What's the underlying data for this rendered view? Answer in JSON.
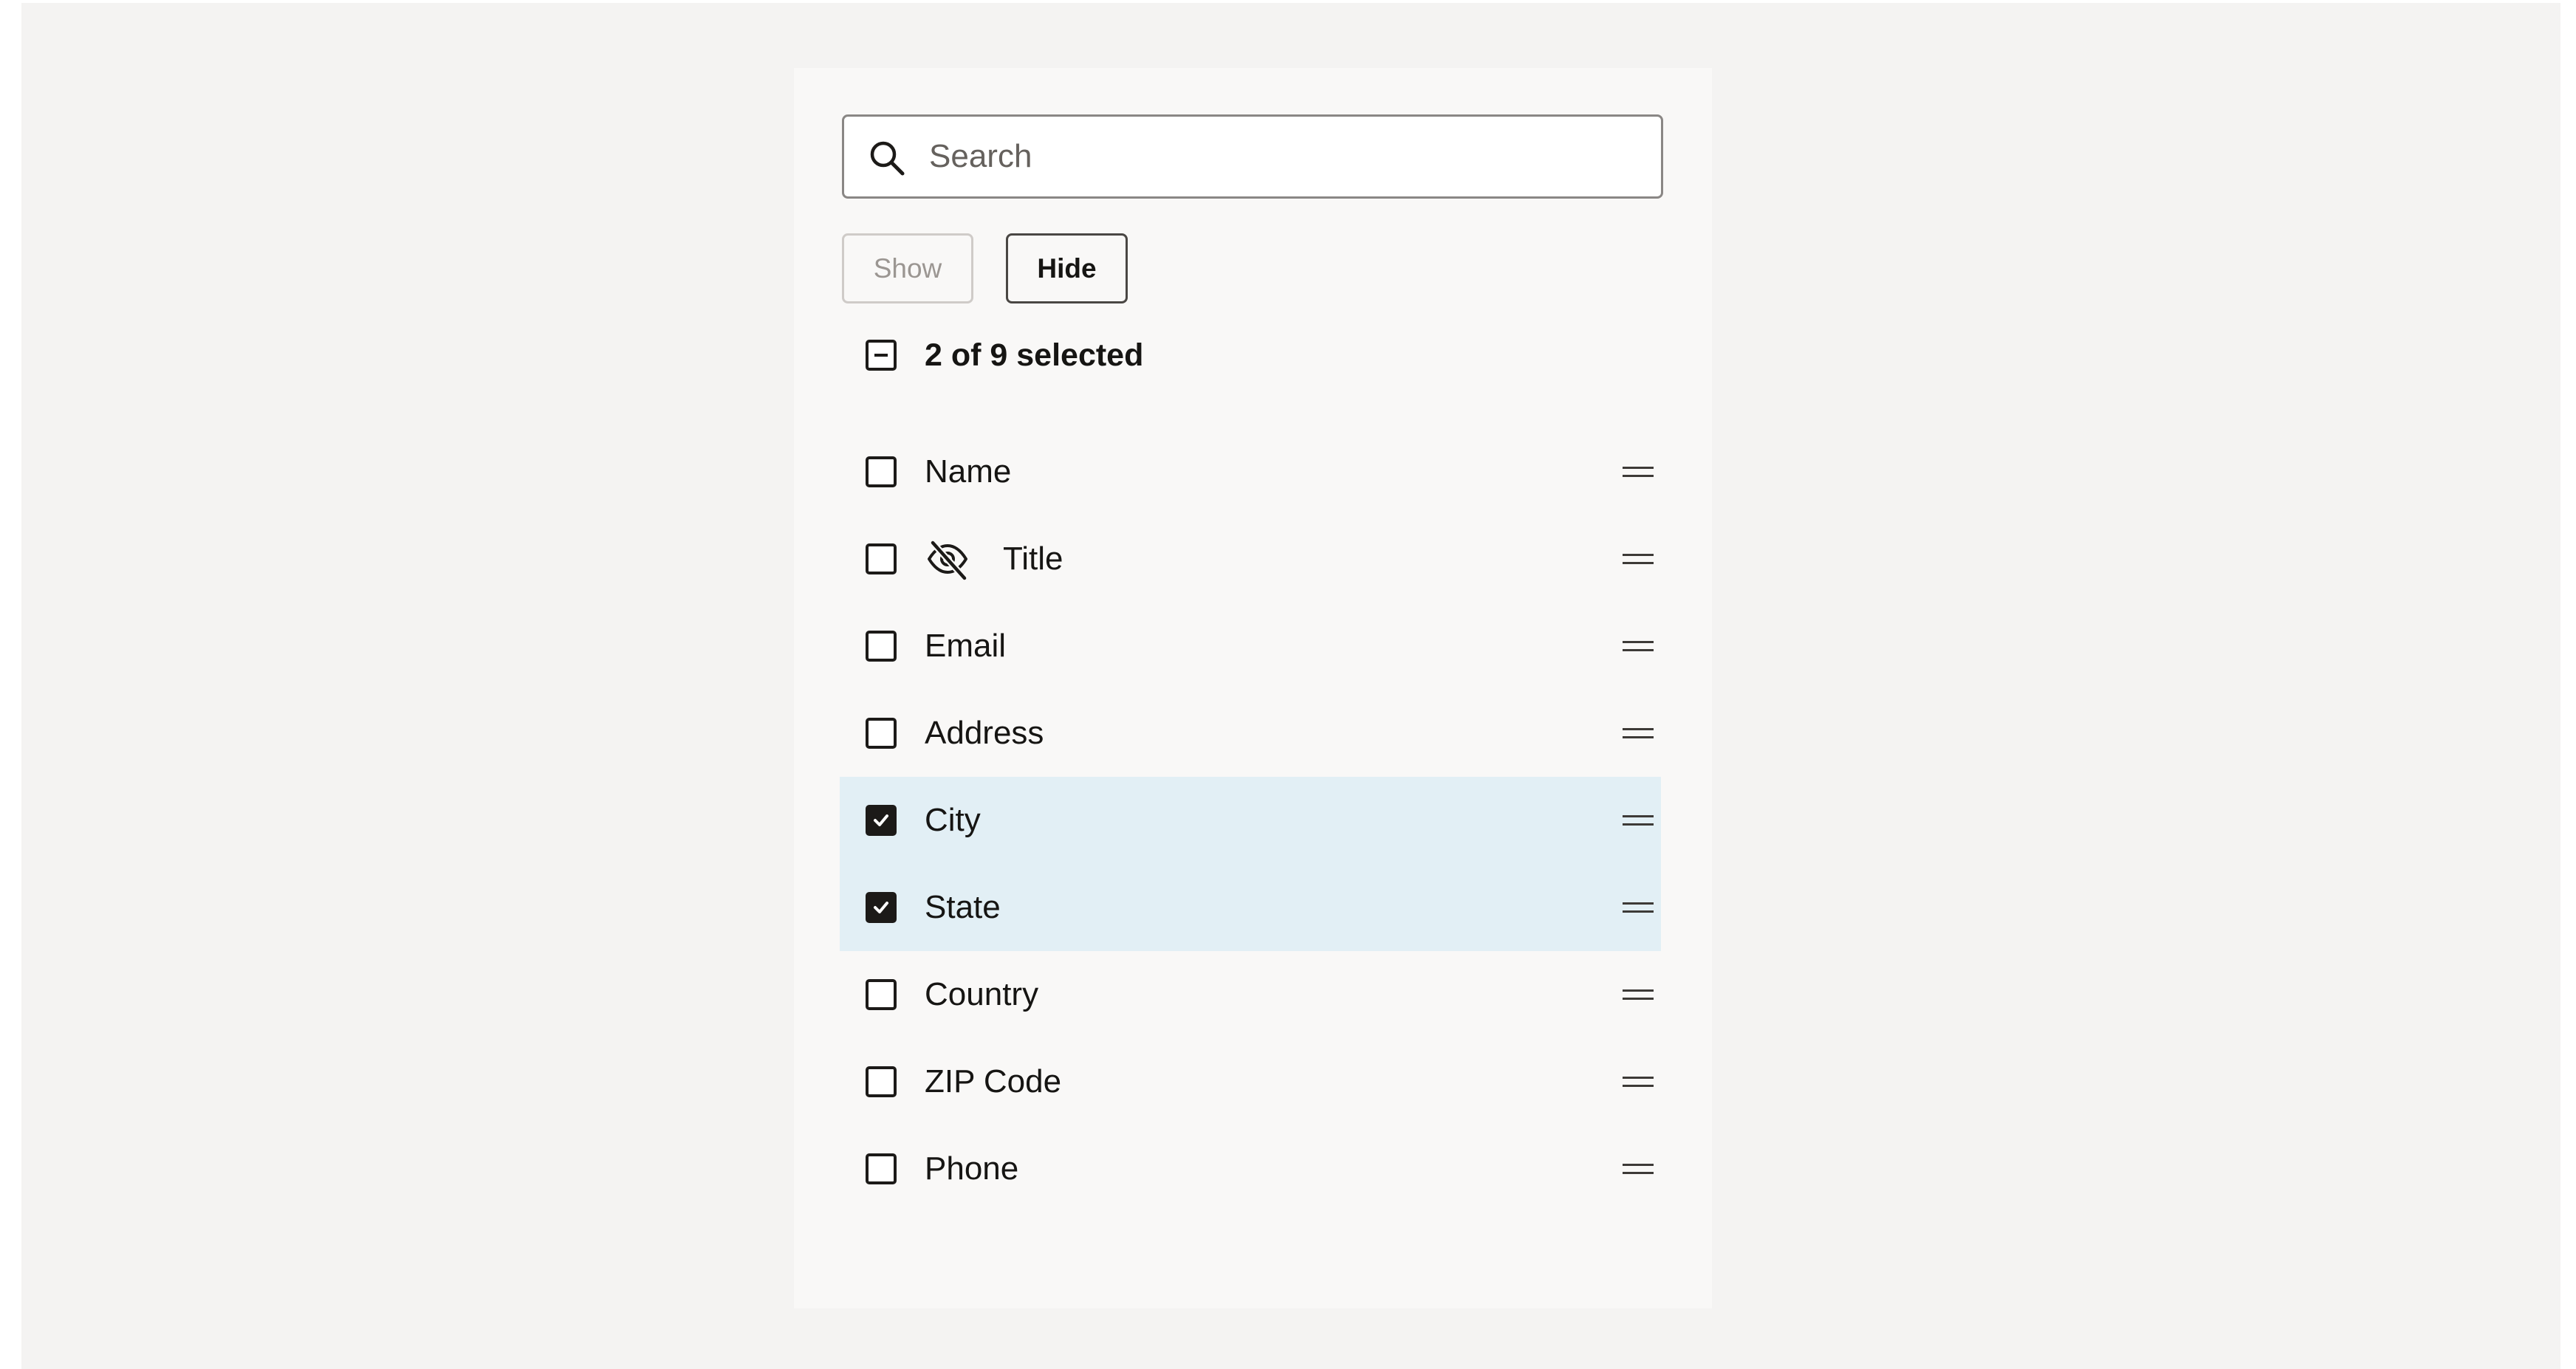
{
  "search": {
    "placeholder": "Search",
    "value": ""
  },
  "actions": {
    "show_label": "Show",
    "hide_label": "Hide",
    "show_disabled": true
  },
  "selection": {
    "summary": "2 of 9 selected",
    "state": "mixed"
  },
  "columns": [
    {
      "label": "Name",
      "checked": false,
      "hidden": false
    },
    {
      "label": "Title",
      "checked": false,
      "hidden": true
    },
    {
      "label": "Email",
      "checked": false,
      "hidden": false
    },
    {
      "label": "Address",
      "checked": false,
      "hidden": false
    },
    {
      "label": "City",
      "checked": true,
      "hidden": false
    },
    {
      "label": "State",
      "checked": true,
      "hidden": false
    },
    {
      "label": "Country",
      "checked": false,
      "hidden": false
    },
    {
      "label": "ZIP Code",
      "checked": false,
      "hidden": false
    },
    {
      "label": "Phone",
      "checked": false,
      "hidden": false
    }
  ],
  "colors": {
    "background": "#f4f3f2",
    "panel": "#f9f8f7",
    "selected_row": "#e2eff5",
    "text": "#161513",
    "disabled_text": "#9b9692"
  },
  "icons": {
    "search": "search-icon",
    "hidden": "eye-off-icon",
    "drag": "drag-handle-icon"
  }
}
